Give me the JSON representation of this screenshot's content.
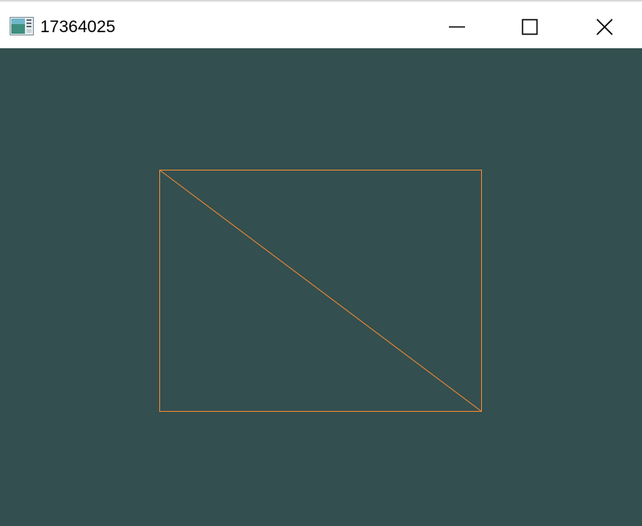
{
  "window": {
    "title": "17364025",
    "app_icon": "app-window-icon",
    "controls": {
      "minimize_icon": "minimize-icon",
      "maximize_icon": "maximize-icon",
      "close_icon": "close-icon"
    }
  },
  "canvas": {
    "background_color": "#344f4f",
    "stroke_color": "#f08a38",
    "shapes": [
      "rectangle-outline",
      "diagonal-line"
    ]
  }
}
